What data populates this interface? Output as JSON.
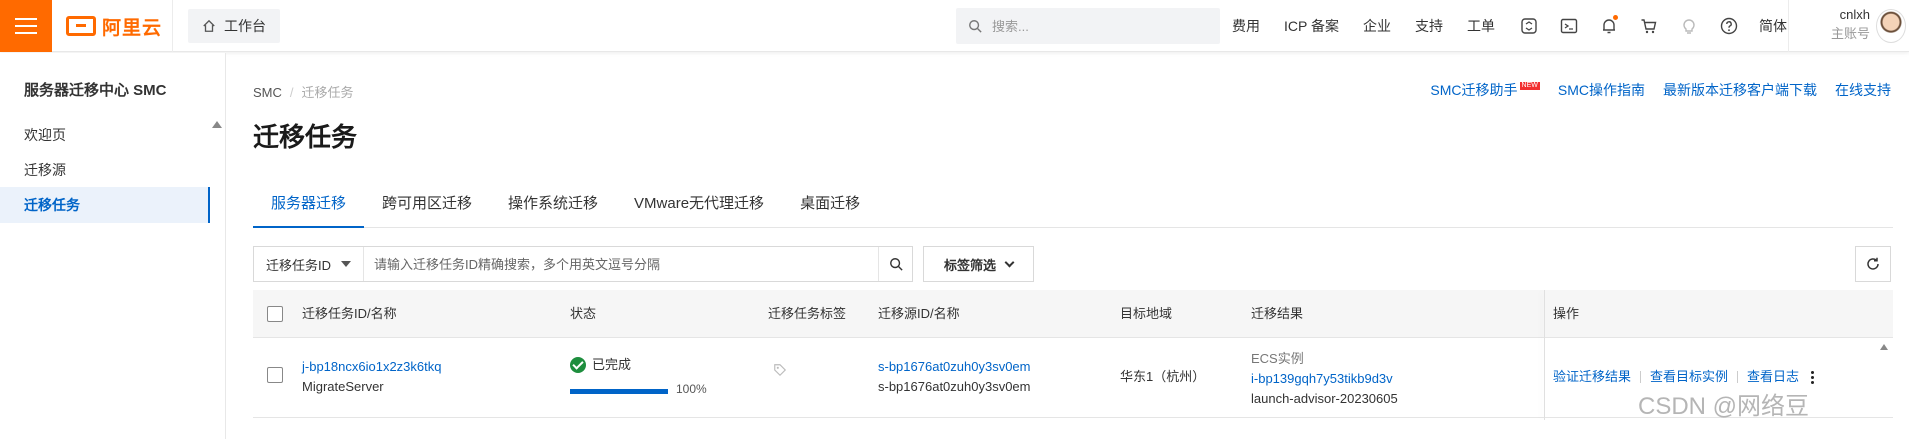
{
  "header": {
    "logo_text": "阿里云",
    "workbench_label": "工作台",
    "search_placeholder": "搜索...",
    "links": [
      "费用",
      "ICP 备案",
      "企业",
      "支持",
      "工单"
    ],
    "language": "简体",
    "user_name": "cnlxh",
    "user_role": "主账号",
    "accent_color": "#ff6a00",
    "icons": [
      "menu-icon",
      "home-icon",
      "search-icon",
      "cloud-shell-icon",
      "terminal-icon",
      "bell-icon",
      "cart-icon",
      "lightbulb-icon",
      "help-icon"
    ]
  },
  "sidebar": {
    "title": "服务器迁移中心 SMC",
    "items": [
      {
        "label": "欢迎页",
        "active": false
      },
      {
        "label": "迁移源",
        "active": false
      },
      {
        "label": "迁移任务",
        "active": true
      }
    ]
  },
  "breadcrumb": {
    "root": "SMC",
    "sep": "/",
    "current": "迁移任务"
  },
  "help_links": {
    "assistant": "SMC迁移助手",
    "assistant_badge": "NEW",
    "guide": "SMC操作指南",
    "download": "最新版本迁移客户端下载",
    "support": "在线支持"
  },
  "page_title": "迁移任务",
  "tabs": [
    {
      "label": "服务器迁移",
      "active": true
    },
    {
      "label": "跨可用区迁移",
      "active": false
    },
    {
      "label": "操作系统迁移",
      "active": false
    },
    {
      "label": "VMware无代理迁移",
      "active": false
    },
    {
      "label": "桌面迁移",
      "active": false
    }
  ],
  "filter": {
    "field": "迁移任务ID",
    "placeholder": "请输入迁移任务ID精确搜索，多个用英文逗号分隔",
    "tag_filter": "标签筛选"
  },
  "table": {
    "columns": [
      "迁移任务ID/名称",
      "状态",
      "迁移任务标签",
      "迁移源ID/名称",
      "目标地域",
      "迁移结果",
      "操作"
    ],
    "rows": [
      {
        "job_id": "j-bp18ncx6io1x2z3k6tkq",
        "job_name": "MigrateServer",
        "status": "已完成",
        "progress": 100,
        "progress_label": "100%",
        "source_id": "s-bp1676at0zuh0y3sv0em",
        "source_name": "s-bp1676at0zuh0y3sv0em",
        "region": "华东1（杭州）",
        "result_type": "ECS实例",
        "result_instance": "i-bp139gqh7y53tikb9d3v",
        "result_name": "launch-advisor-20230605",
        "actions": [
          "验证迁移结果",
          "查看目标实例",
          "查看日志"
        ]
      }
    ]
  },
  "colors": {
    "link": "#0064c8",
    "success": "#1e8e3e"
  },
  "watermark": "CSDN @网络豆"
}
